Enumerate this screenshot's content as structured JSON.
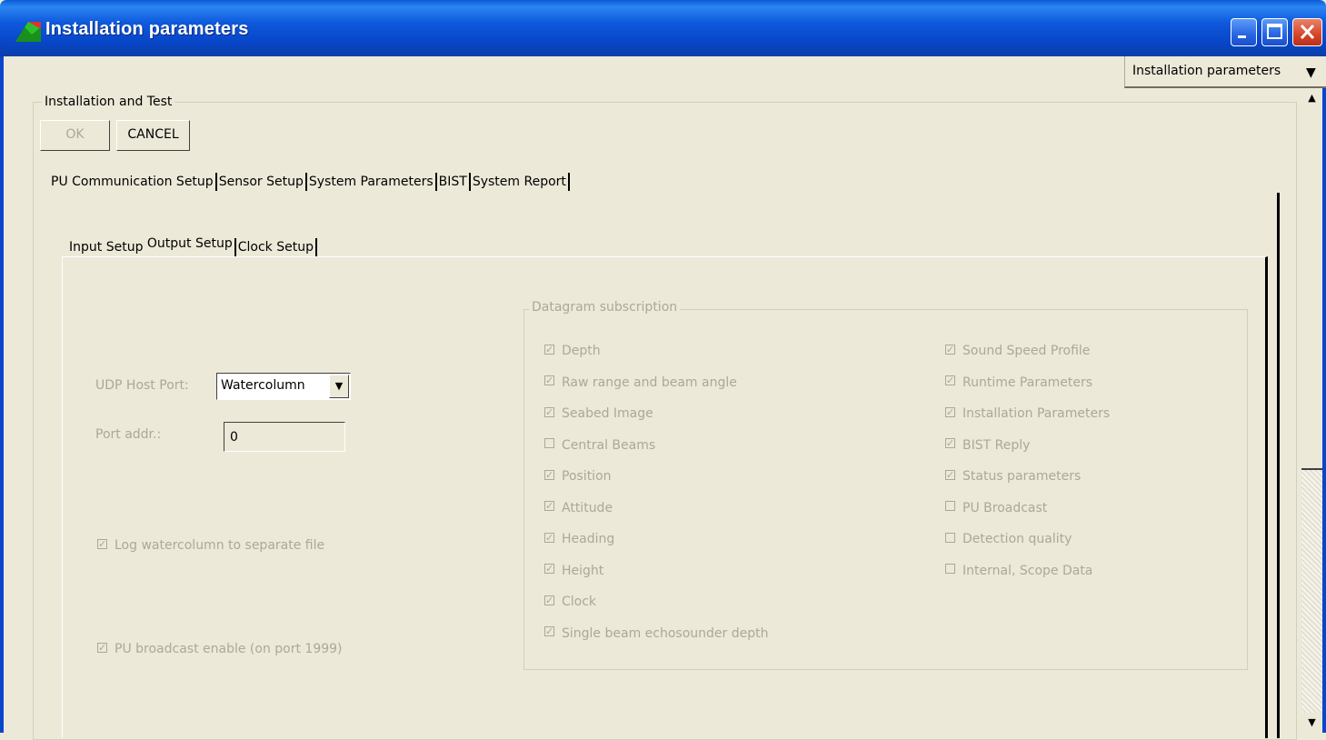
{
  "window": {
    "title": "Installation parameters"
  },
  "top_dropdown": {
    "value": "Installation parameters"
  },
  "group_main": {
    "label": "Installation and Test"
  },
  "buttons": {
    "ok": "OK",
    "cancel": "CANCEL"
  },
  "outer_tabs": [
    "PU Communication Setup",
    "Sensor Setup",
    "System Parameters",
    "BIST",
    "System Report"
  ],
  "inner_tabs": [
    "Input Setup",
    "Output Setup",
    "Clock Setup"
  ],
  "output": {
    "udp_host_port_label": "UDP Host Port:",
    "udp_host_port_value": "Watercolumn",
    "port_addr_label": "Port addr.:",
    "port_addr_value": "0",
    "log_watercolumn": {
      "label": "Log watercolumn to separate file",
      "checked": true
    },
    "pu_broadcast": {
      "label": "PU broadcast enable (on port 1999)",
      "checked": true
    }
  },
  "datagram": {
    "label": "Datagram subscription",
    "left": [
      {
        "label": "Depth",
        "checked": true
      },
      {
        "label": "Raw range and beam angle",
        "checked": true
      },
      {
        "label": "Seabed Image",
        "checked": true
      },
      {
        "label": "Central Beams",
        "checked": false
      },
      {
        "label": "Position",
        "checked": true
      },
      {
        "label": "Attitude",
        "checked": true
      },
      {
        "label": "Heading",
        "checked": true
      },
      {
        "label": "Height",
        "checked": true
      },
      {
        "label": "Clock",
        "checked": true
      },
      {
        "label": "Single beam echosounder depth",
        "checked": true
      }
    ],
    "right": [
      {
        "label": "Sound Speed Profile",
        "checked": true
      },
      {
        "label": "Runtime Parameters",
        "checked": true
      },
      {
        "label": "Installation Parameters",
        "checked": true
      },
      {
        "label": "BIST Reply",
        "checked": true
      },
      {
        "label": "Status parameters",
        "checked": true
      },
      {
        "label": "PU Broadcast",
        "checked": false
      },
      {
        "label": "Detection quality",
        "checked": false
      },
      {
        "label": "Internal, Scope Data",
        "checked": false
      }
    ]
  }
}
